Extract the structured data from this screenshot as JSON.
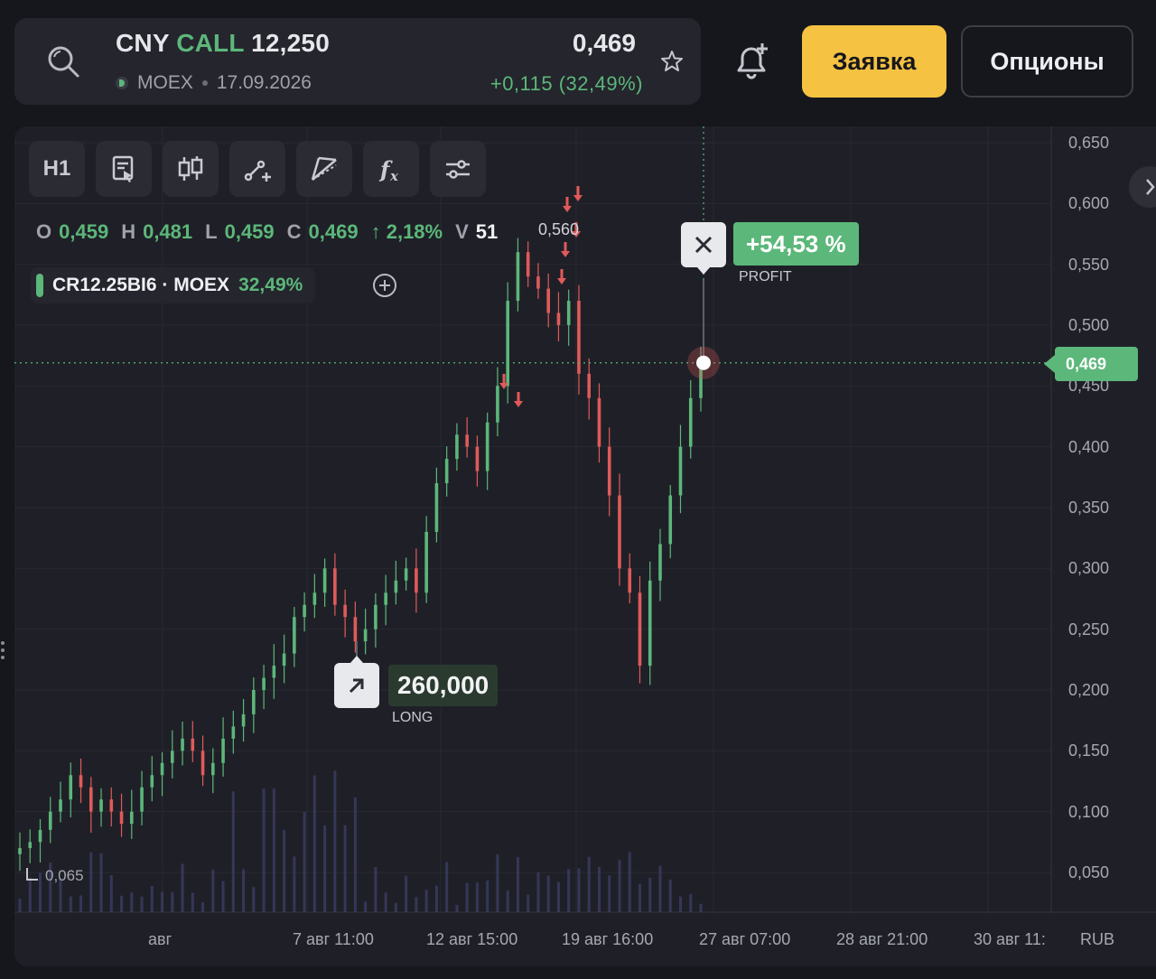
{
  "header": {
    "ticker_base": "CNY",
    "ticker_type": "CALL",
    "ticker_strike": "12,250",
    "exchange": "MOEX",
    "expiry": "17.09.2026",
    "price": "0,469",
    "change": "+0,115 (32,49%)",
    "order_button": "Заявка",
    "options_button": "Опционы"
  },
  "toolbar": {
    "interval": "H1"
  },
  "ohlc": {
    "o_label": "O",
    "o": "0,459",
    "h_label": "H",
    "h": "0,481",
    "l_label": "L",
    "l": "0,459",
    "c_label": "C",
    "c": "0,469",
    "change": "↑ 2,18%",
    "v_label": "V",
    "v": "51"
  },
  "legend": {
    "symbol": "CR12.25BI6 · MOEX",
    "change": "32,49%"
  },
  "annotations": {
    "max_price": "0,560",
    "min_price": "0,065",
    "current_price": "0,469",
    "profit_value": "+54,53 %",
    "profit_caption": "PROFIT",
    "long_value": "260,000",
    "long_caption": "LONG"
  },
  "chart_data": {
    "type": "candlestick",
    "y_axis": {
      "ticks": [
        "0,650",
        "0,600",
        "0,550",
        "0,500",
        "0,450",
        "0,400",
        "0,350",
        "0,300",
        "0,250",
        "0,200",
        "0,150",
        "0,100",
        "0,050"
      ],
      "range": [
        0.02,
        0.66
      ],
      "currency": "RUB"
    },
    "x_axis": {
      "ticks": [
        "авг",
        "7 авг 11:00",
        "12 авг 15:00",
        "19 авг 16:00",
        "27 авг 07:00",
        "28 авг 21:00",
        "30 авг 11:"
      ]
    },
    "close_series": [
      0.07,
      0.075,
      0.085,
      0.1,
      0.11,
      0.13,
      0.12,
      0.1,
      0.11,
      0.1,
      0.09,
      0.1,
      0.12,
      0.13,
      0.14,
      0.15,
      0.16,
      0.15,
      0.13,
      0.14,
      0.16,
      0.17,
      0.18,
      0.2,
      0.21,
      0.22,
      0.23,
      0.26,
      0.27,
      0.28,
      0.3,
      0.27,
      0.26,
      0.24,
      0.25,
      0.27,
      0.28,
      0.29,
      0.3,
      0.28,
      0.33,
      0.37,
      0.39,
      0.41,
      0.4,
      0.38,
      0.42,
      0.45,
      0.52,
      0.56,
      0.54,
      0.53,
      0.51,
      0.5,
      0.52,
      0.46,
      0.44,
      0.4,
      0.36,
      0.3,
      0.28,
      0.22,
      0.29,
      0.32,
      0.36,
      0.4,
      0.44,
      0.469
    ],
    "current": 0.469,
    "series": [
      {
        "name": "CR12.25BI6 · MOEX",
        "change": "32,49%"
      }
    ]
  }
}
